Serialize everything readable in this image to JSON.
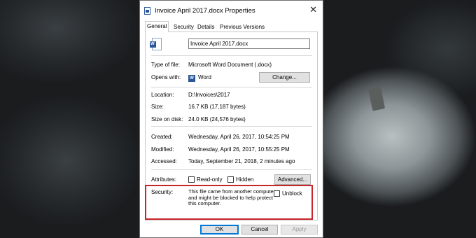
{
  "window": {
    "title": "Invoice April 2017.docx Properties",
    "close_glyph": "✕"
  },
  "tabs": [
    {
      "label": "General"
    },
    {
      "label": "Security"
    },
    {
      "label": "Details"
    },
    {
      "label": "Previous Versions"
    }
  ],
  "general": {
    "file_name": "Invoice April 2017.docx",
    "type_of_file_label": "Type of file:",
    "type_of_file_value": "Microsoft Word Document (.docx)",
    "opens_with_label": "Opens with:",
    "opens_with_app": "Word",
    "change_button": "Change...",
    "location_label": "Location:",
    "location_value": "D:\\Invoices\\2017",
    "size_label": "Size:",
    "size_value": "16.7 KB (17,187 bytes)",
    "size_on_disk_label": "Size on disk:",
    "size_on_disk_value": "24.0 KB (24,576 bytes)",
    "created_label": "Created:",
    "created_value": "Wednesday, April 26, 2017, 10:54:25 PM",
    "modified_label": "Modified:",
    "modified_value": "Wednesday, April 26, 2017, 10:55:25 PM",
    "accessed_label": "Accessed:",
    "accessed_value": "Today, September 21, 2018, 2 minutes ago",
    "attributes_label": "Attributes:",
    "readonly_label": "Read-only",
    "hidden_label": "Hidden",
    "advanced_button": "Advanced...",
    "security_label": "Security:",
    "security_text": "This file came from another computer and might be blocked to help protect this computer.",
    "unblock_label": "Unblock"
  },
  "footer": {
    "ok": "OK",
    "cancel": "Cancel",
    "apply": "Apply"
  },
  "colors": {
    "accent": "#0078d7",
    "highlight": "#c8242b",
    "word": "#2b579a"
  }
}
